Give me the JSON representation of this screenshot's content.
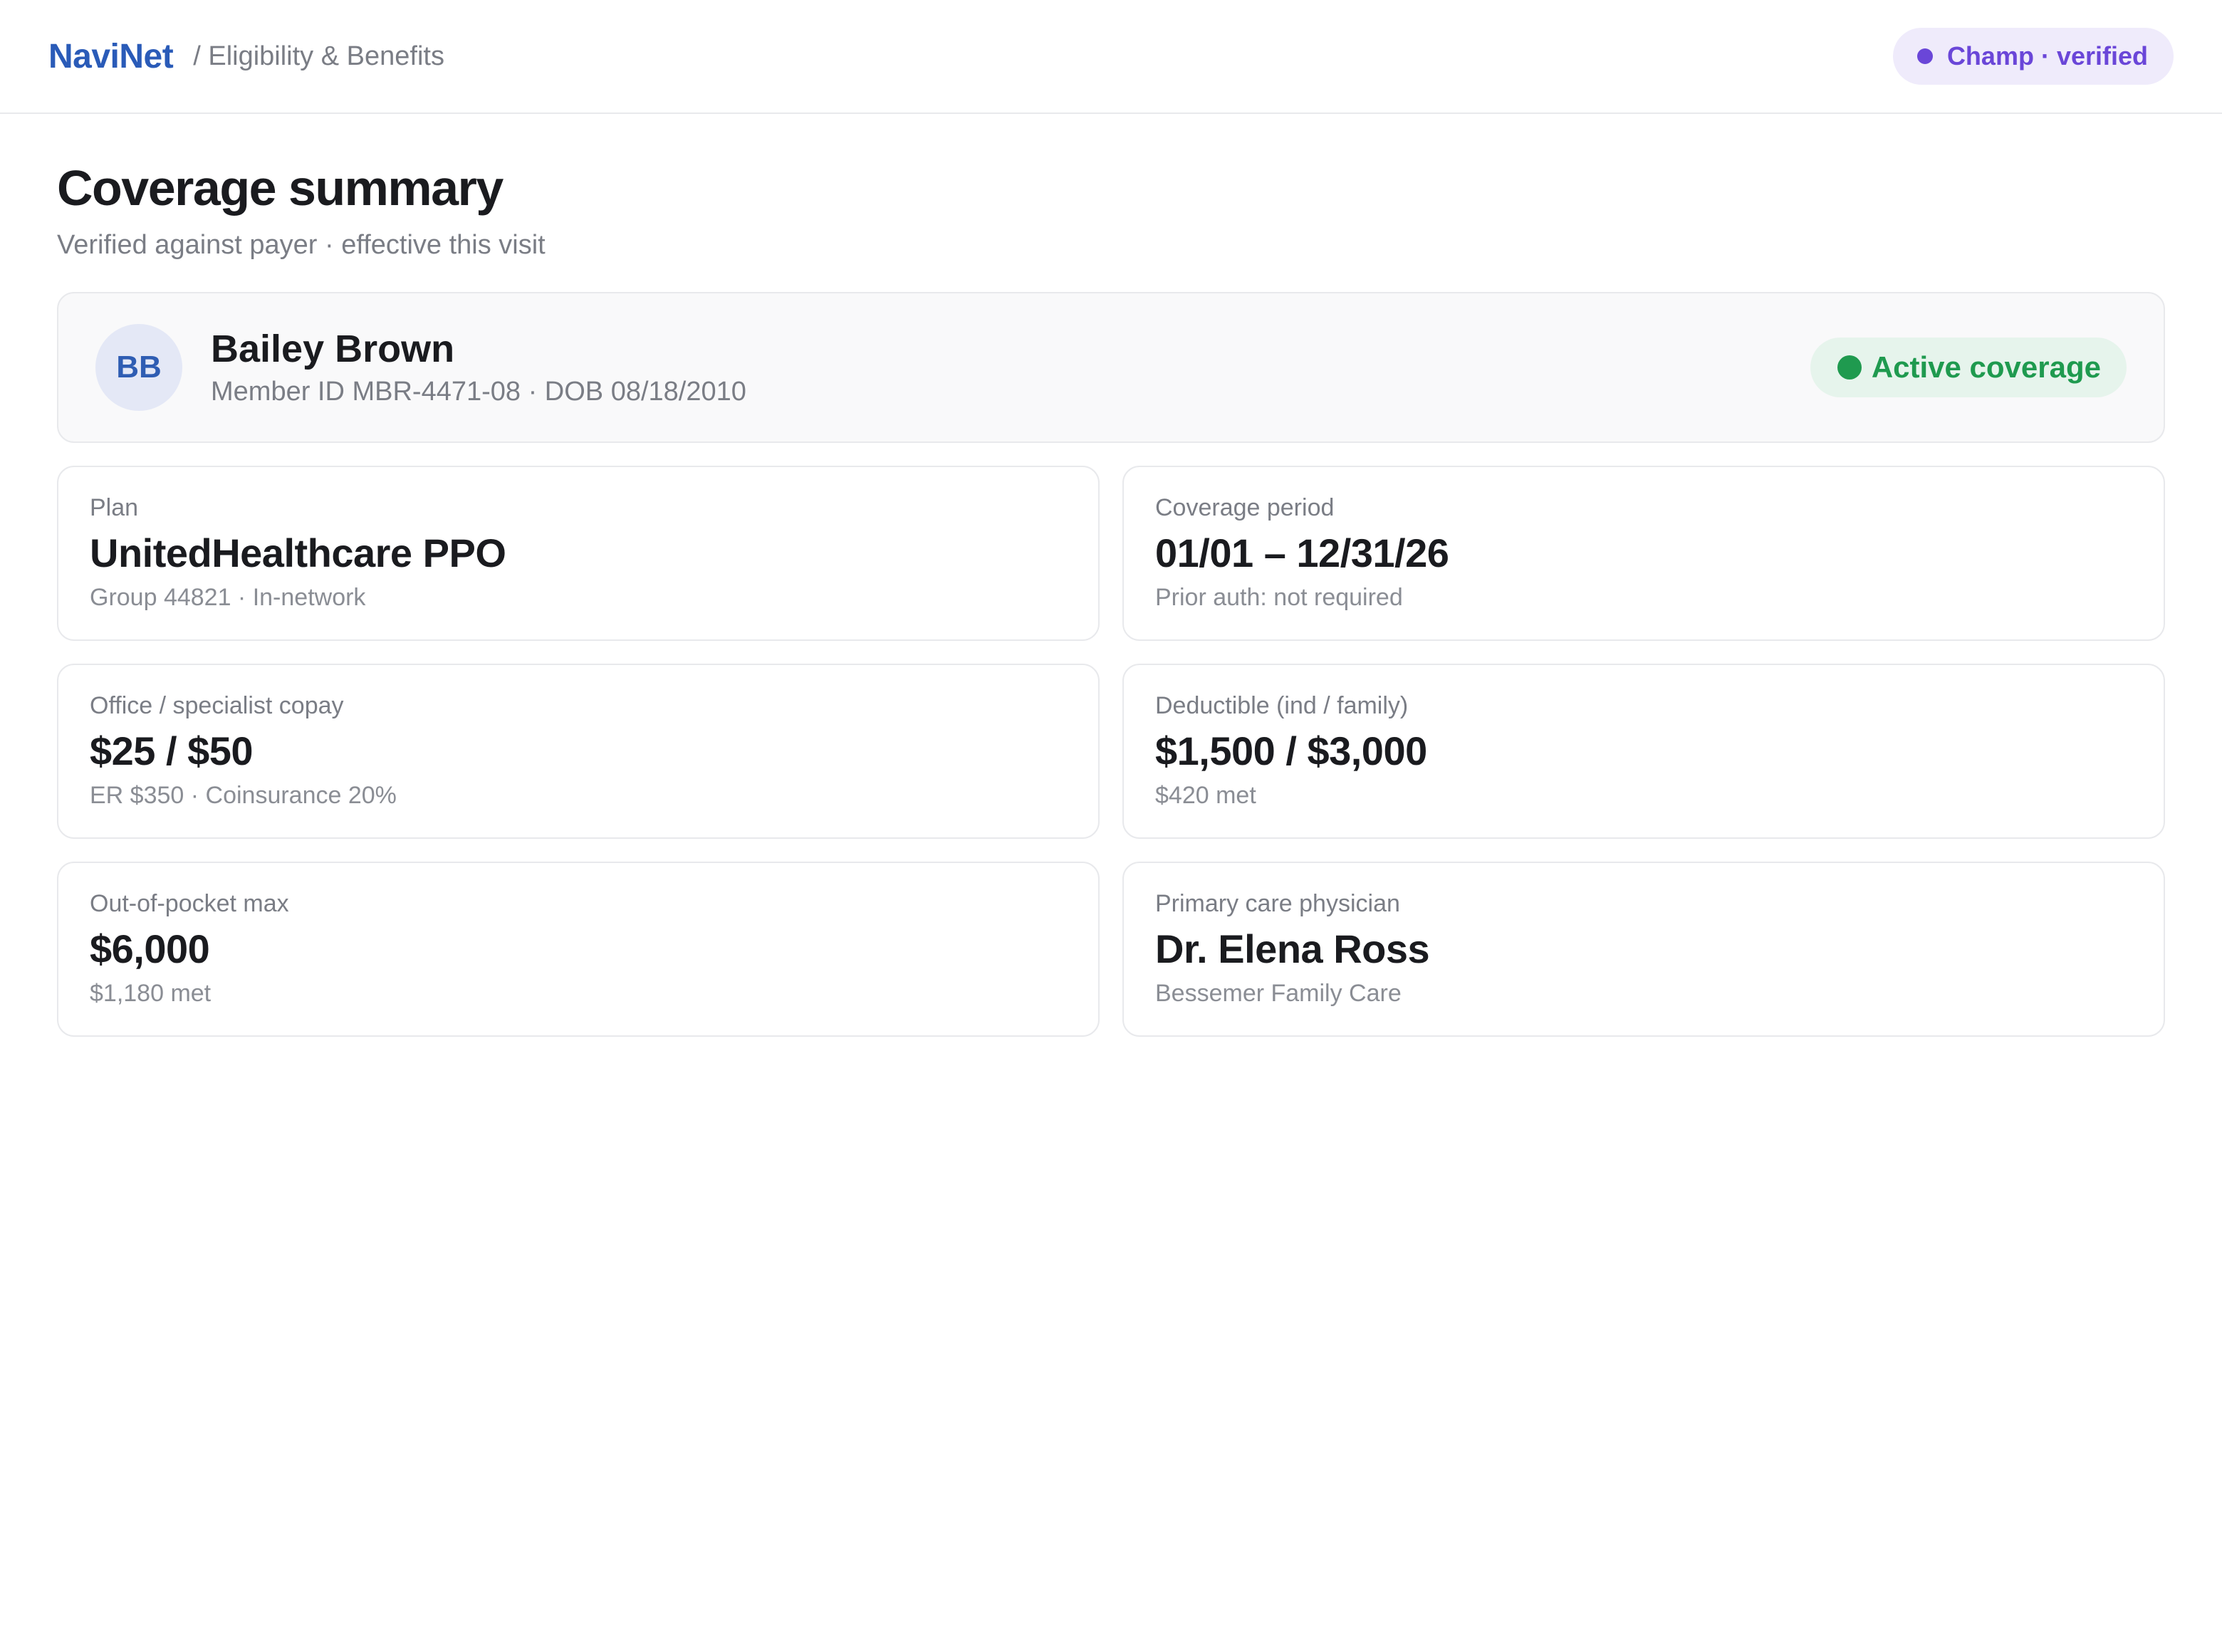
{
  "header": {
    "brand": "NaviNet",
    "breadcrumb": "/ Eligibility & Benefits",
    "status_badge": "Champ · verified"
  },
  "page": {
    "title": "Coverage summary",
    "subtitle": "Verified against payer · effective this visit"
  },
  "member": {
    "initials": "BB",
    "name": "Bailey Brown",
    "meta": "Member ID MBR-4471-08 · DOB 08/18/2010",
    "status": "Active coverage"
  },
  "tiles": [
    {
      "label": "Plan",
      "value": "UnitedHealthcare PPO",
      "sub": "Group 44821 · In-network"
    },
    {
      "label": "Coverage period",
      "value": "01/01 – 12/31/26",
      "sub": "Prior auth: not required"
    },
    {
      "label": "Office / specialist copay",
      "value": "$25 / $50",
      "sub": "ER $350 · Coinsurance 20%"
    },
    {
      "label": "Deductible (ind / family)",
      "value": "$1,500 / $3,000",
      "sub": "$420 met"
    },
    {
      "label": "Out-of-pocket max",
      "value": "$6,000",
      "sub": "$1,180 met"
    },
    {
      "label": "Primary care physician",
      "value": "Dr. Elena Ross",
      "sub": "Bessemer Family Care"
    }
  ],
  "colors": {
    "brand": "#2a5bb8",
    "champ_accent": "#6a46d8",
    "active_green": "#1f9a4f"
  }
}
